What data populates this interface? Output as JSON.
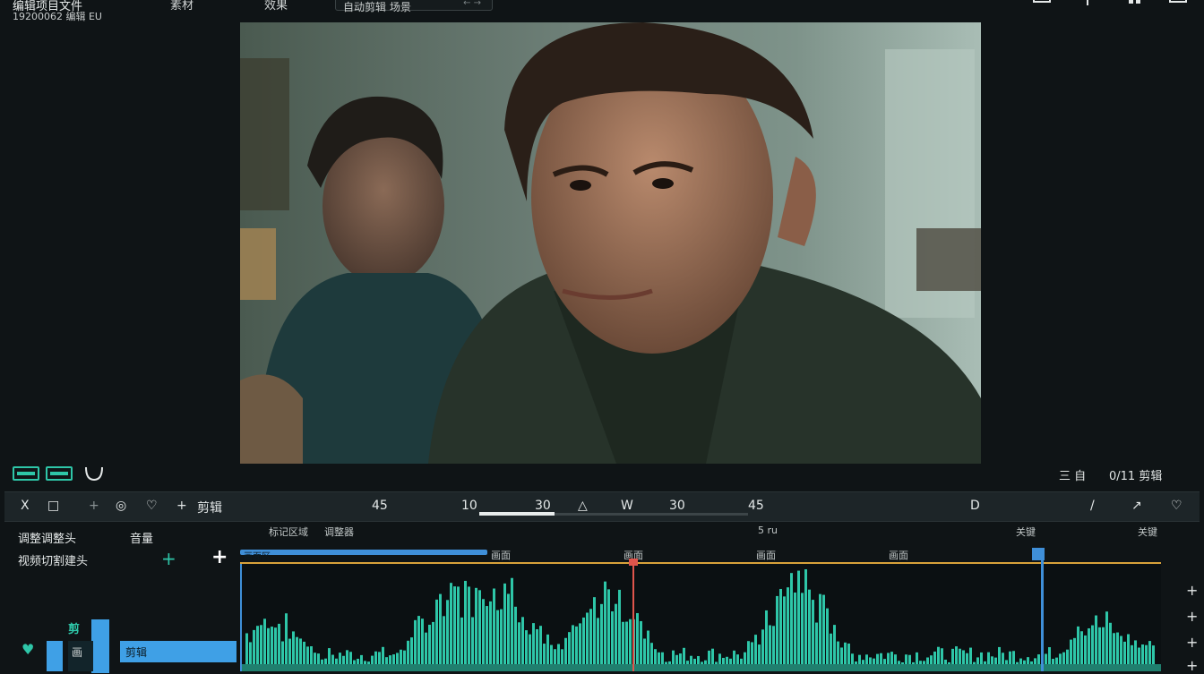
{
  "header": {
    "title": "编辑项目文件",
    "subtitle": "19200062 编辑 EU",
    "menu": [
      "素材",
      "效果"
    ],
    "search_text": "自动剪辑 场景",
    "search_arrows": "← →"
  },
  "preview": {
    "description_icon": "video-frame"
  },
  "controls_row": {
    "right_a": "三 自",
    "right_b": "0/11 剪辑"
  },
  "toolbar": {
    "items": [
      "X",
      "□",
      "+",
      "◎",
      "♡",
      "+",
      "剪辑"
    ],
    "center": [
      "45",
      "10",
      "30",
      "△",
      "W",
      "30",
      "45"
    ],
    "right": [
      "D",
      "/",
      "↗",
      "♡"
    ],
    "scrub_progress": 0.28
  },
  "tracks": {
    "label_1": "调整调整头",
    "label_1b": "音量",
    "label_2": "视频切割建头",
    "ruler": [
      "标记区域",
      "调整器",
      "5 ru",
      "关键",
      "关键"
    ],
    "ruler_sub": [
      "画面",
      "画面",
      "画面",
      "画面"
    ],
    "clip_label": "画面区",
    "left_badges": [
      "剪",
      "画",
      "剪辑"
    ]
  },
  "colors": {
    "accent": "#2ec6a8",
    "playhead": "#e0554c",
    "selection": "#3f8fd8",
    "marker_line": "#d9a23a"
  }
}
